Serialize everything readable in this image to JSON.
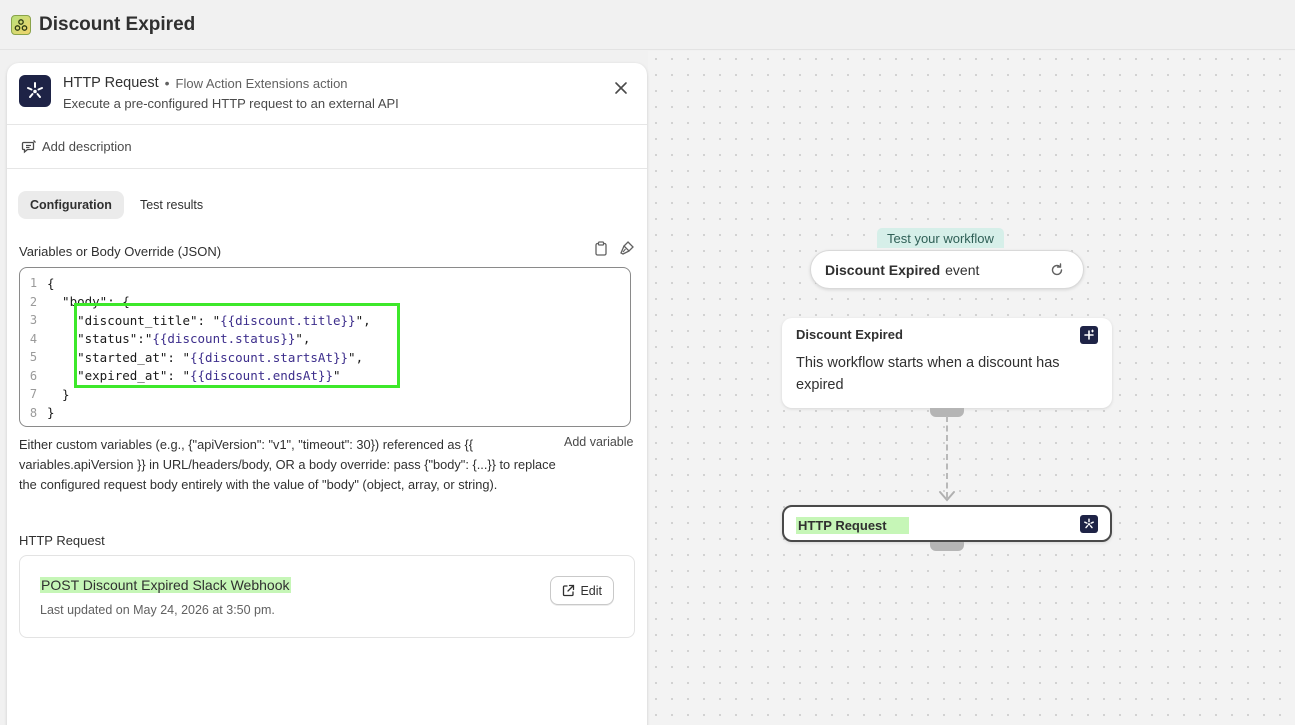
{
  "app": {
    "title": "Discount Expired"
  },
  "panel": {
    "title": "HTTP Request",
    "separator": "•",
    "kind": "Flow Action Extensions action",
    "subtitle": "Execute a pre-configured HTTP request to an external API",
    "add_description": "Add description",
    "tabs": [
      {
        "label": "Configuration",
        "active": true
      },
      {
        "label": "Test results",
        "active": false
      }
    ],
    "field_label": "Variables or Body Override (JSON)",
    "code_lines": [
      {
        "n": "1",
        "text": "{",
        "tmpl": "",
        "after": ""
      },
      {
        "n": "2",
        "text": "  \"body\": {",
        "tmpl": "",
        "after": ""
      },
      {
        "n": "3",
        "text": "    \"discount_title\": \"",
        "tmpl": "{{discount.title}}",
        "after": "\","
      },
      {
        "n": "4",
        "text": "    \"status\":\"",
        "tmpl": "{{discount.status}}",
        "after": "\","
      },
      {
        "n": "5",
        "text": "    \"started_at\": \"",
        "tmpl": "{{discount.startsAt}}",
        "after": "\","
      },
      {
        "n": "6",
        "text": "    \"expired_at\": \"",
        "tmpl": "{{discount.endsAt}}",
        "after": "\""
      },
      {
        "n": "7",
        "text": "  }",
        "tmpl": "",
        "after": ""
      },
      {
        "n": "8",
        "text": "}",
        "tmpl": "",
        "after": ""
      }
    ],
    "help_text": "Either custom variables (e.g., {\"apiVersion\": \"v1\", \"timeout\": 30}) referenced as {{ variables.apiVersion }} in URL/headers/body, OR a body override: pass {\"body\": {...}} to replace the configured request body entirely with the value of \"body\" (object, array, or string).",
    "add_variable": "Add variable",
    "section_label": "HTTP Request",
    "request": {
      "name": "POST Discount Expired Slack Webhook",
      "meta": "Last updated on May 24, 2026 at 3:50 pm.",
      "edit_label": "Edit"
    }
  },
  "canvas": {
    "test_label": "Test your workflow",
    "trigger_name": "Discount Expired",
    "trigger_suffix": "event",
    "node1": {
      "title": "Discount Expired",
      "description": "This workflow starts when a discount has expired"
    },
    "node2": {
      "title": "HTTP Request"
    }
  },
  "colors": {
    "highlight_green": "#3de82a",
    "highlight_fill": "#c6f6b7",
    "action_icon_bg": "#1e2346",
    "test_label_bg": "#d6efe9"
  },
  "icons": {
    "app": "workflow-app-icon",
    "action": "sparkle-burst-icon",
    "close": "close-icon",
    "description": "comment-edit-icon",
    "clipboard": "clipboard-icon",
    "format": "brush-icon",
    "external": "external-link-icon",
    "refresh": "refresh-icon",
    "add_trigger": "plus-sparkle-icon"
  }
}
